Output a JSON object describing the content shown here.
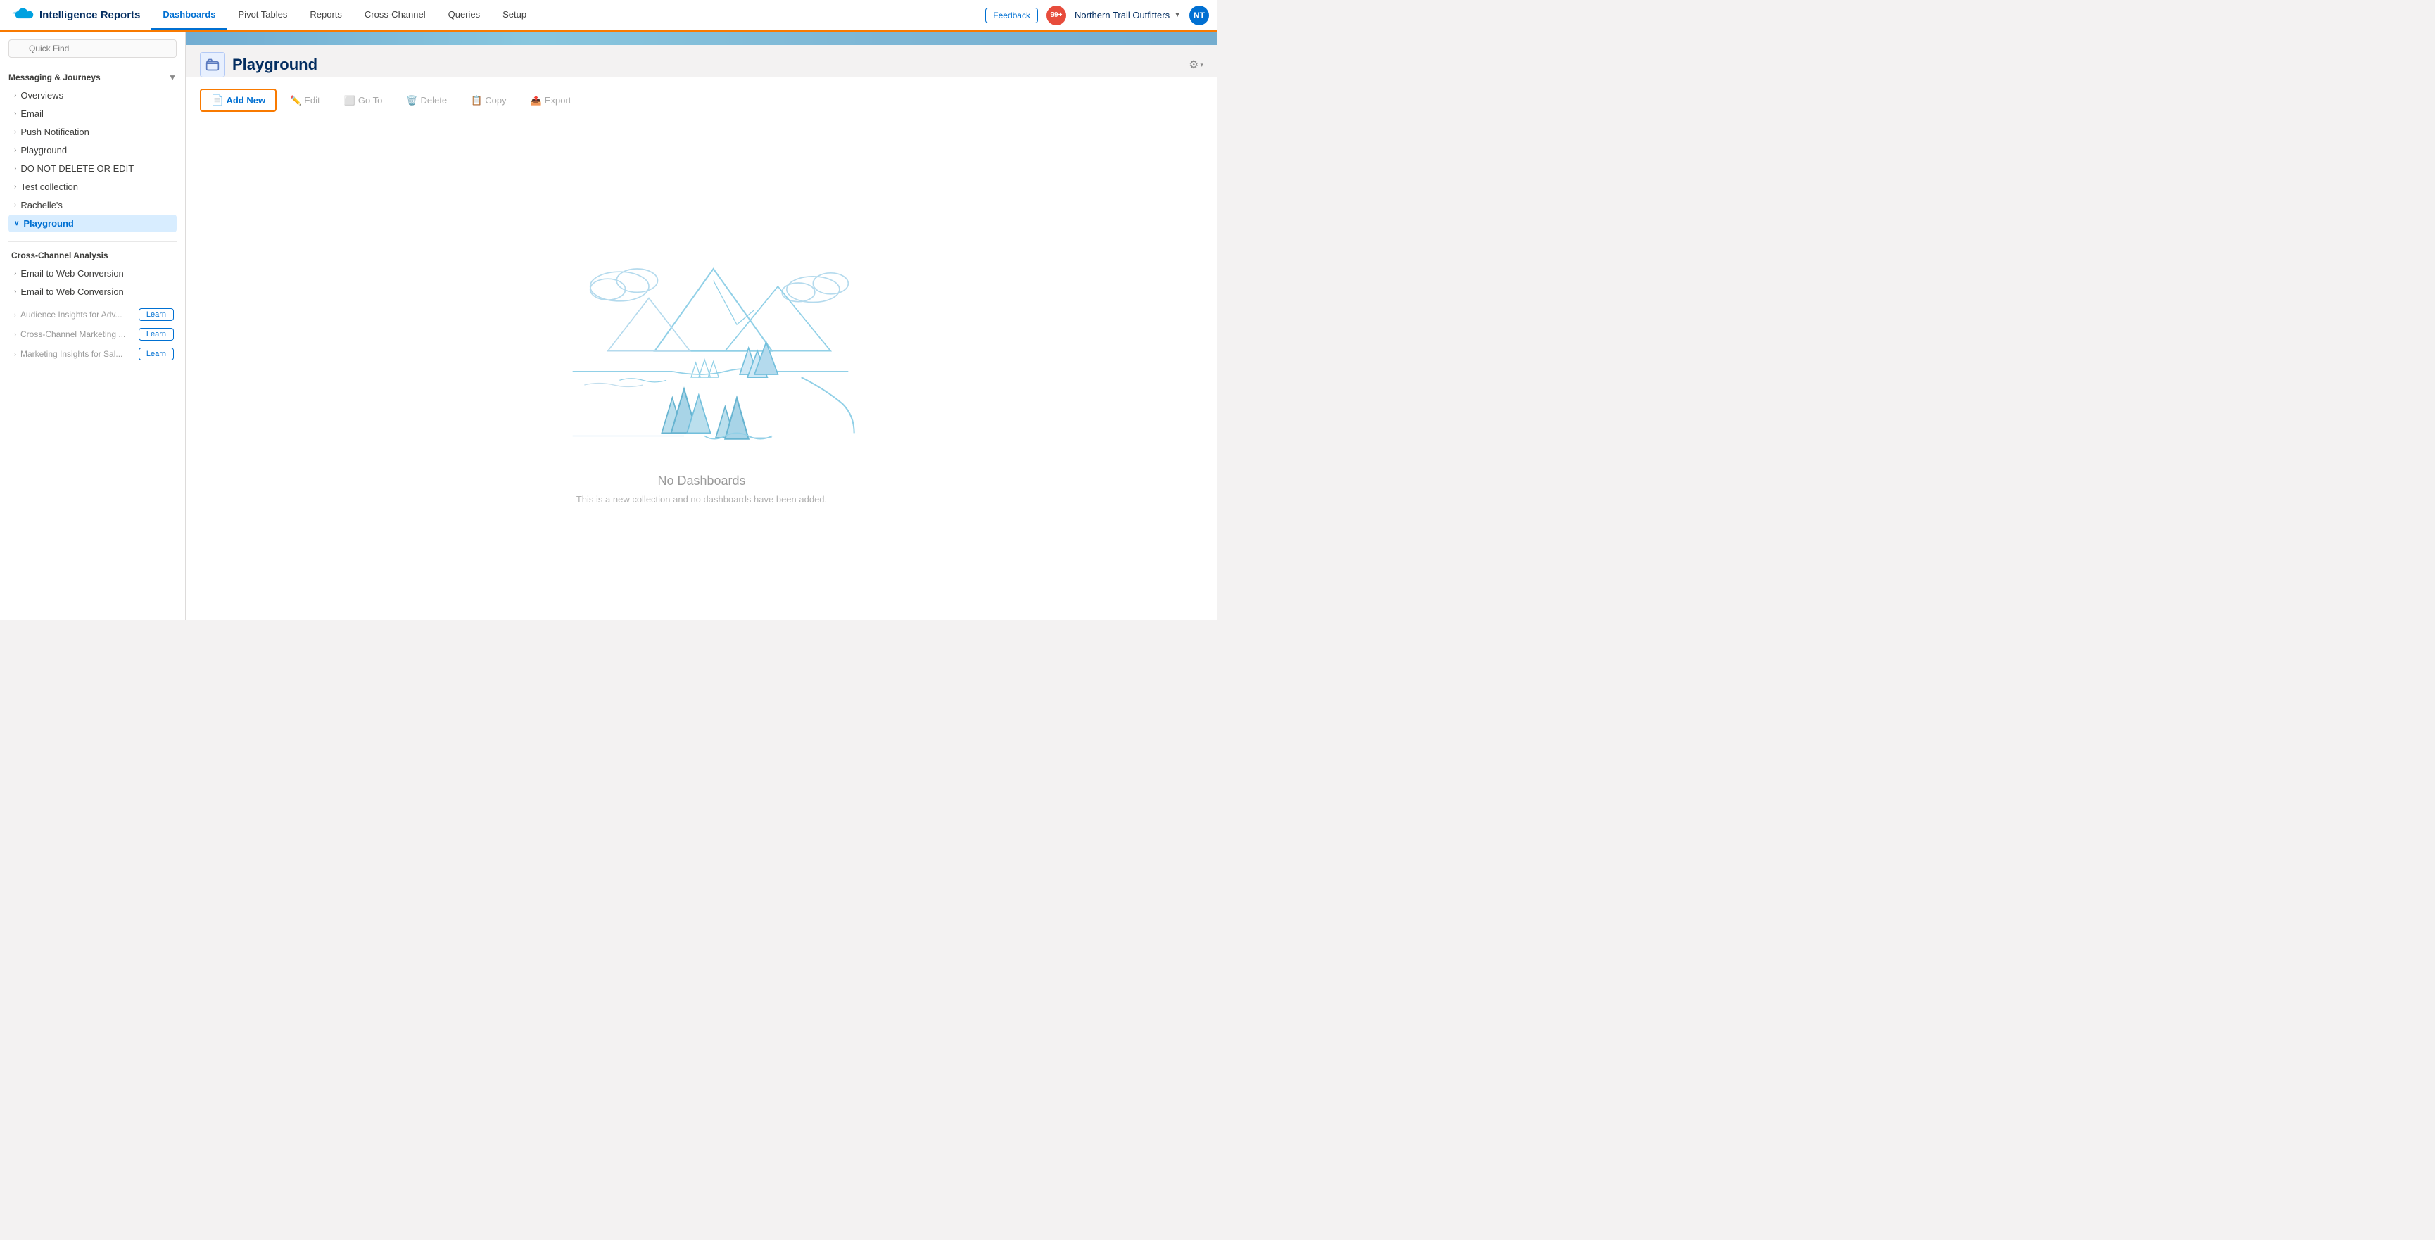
{
  "app": {
    "logo_alt": "Salesforce",
    "title": "Intelligence Reports"
  },
  "nav": {
    "tabs": [
      {
        "label": "Dashboards",
        "active": true
      },
      {
        "label": "Pivot Tables",
        "active": false
      },
      {
        "label": "Reports",
        "active": false
      },
      {
        "label": "Cross-Channel",
        "active": false
      },
      {
        "label": "Queries",
        "active": false
      },
      {
        "label": "Setup",
        "active": false
      }
    ],
    "feedback_label": "Feedback",
    "notification_count": "99+",
    "org_name": "Northern Trail Outfitters",
    "user_initials": "NT"
  },
  "sidebar": {
    "search_placeholder": "Quick Find",
    "section1_title": "Messaging & Journeys",
    "items": [
      {
        "label": "Overviews",
        "active": false,
        "chevron": "›"
      },
      {
        "label": "Email",
        "active": false,
        "chevron": "›"
      },
      {
        "label": "Push Notification",
        "active": false,
        "chevron": "›"
      },
      {
        "label": "Playground",
        "active": false,
        "chevron": "›"
      },
      {
        "label": "DO NOT DELETE OR EDIT",
        "active": false,
        "chevron": "›"
      },
      {
        "label": "Test collection",
        "active": false,
        "chevron": "›"
      },
      {
        "label": "Rachelle's",
        "active": false,
        "chevron": "›"
      },
      {
        "label": "Playground",
        "active": true,
        "chevron": "∨"
      }
    ],
    "section2_title": "Cross-Channel Analysis",
    "cross_channel_items": [
      {
        "label": "Email to Web Conversion",
        "active": false,
        "chevron": "›"
      },
      {
        "label": "Email to Web Conversion",
        "active": false,
        "chevron": "›"
      }
    ],
    "learn_items": [
      {
        "label": "Audience Insights for Adv...",
        "btn": "Learn"
      },
      {
        "label": "Cross-Channel Marketing ...",
        "btn": "Learn"
      },
      {
        "label": "Marketing Insights for Sal...",
        "btn": "Learn"
      }
    ]
  },
  "content": {
    "folder_icon": "▣",
    "title": "Playground",
    "settings_icon": "⚙",
    "toolbar": {
      "add_new": "Add New",
      "edit": "Edit",
      "go_to": "Go To",
      "delete": "Delete",
      "copy": "Copy",
      "export": "Export"
    },
    "empty_title": "No Dashboards",
    "empty_sub": "This is a new collection and no dashboards have been added."
  },
  "colors": {
    "brand_blue": "#0070d2",
    "brand_orange": "#f97a00",
    "active_bg": "#d8edff",
    "illustration_blue": "#7ec8e3",
    "illustration_light": "#b8d9ea"
  }
}
